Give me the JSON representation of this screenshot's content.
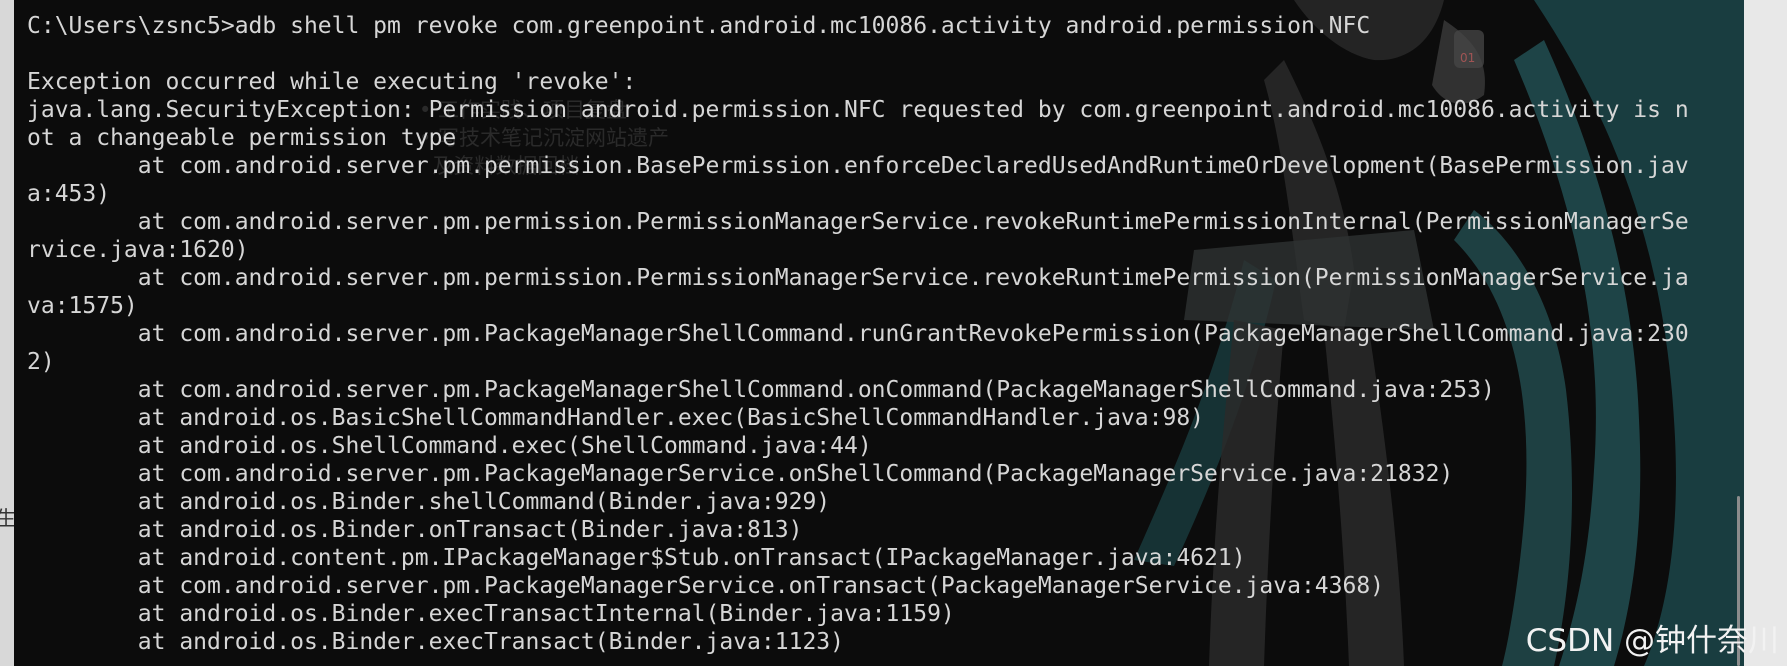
{
  "background_label": "生成目录",
  "faint_text": [
    "• 工作实践、项目复盘",
    "• 写技术笔记沉淀网站遗产",
    "  及资料数据回档"
  ],
  "terminal": {
    "lines": [
      "C:\\Users\\zsnc5>adb shell pm revoke com.greenpoint.android.mc10086.activity android.permission.NFC",
      "",
      "Exception occurred while executing 'revoke':",
      "java.lang.SecurityException: Permission android.permission.NFC requested by com.greenpoint.android.mc10086.activity is n",
      "ot a changeable permission type",
      "        at com.android.server.pm.permission.BasePermission.enforceDeclaredUsedAndRuntimeOrDevelopment(BasePermission.jav",
      "a:453)",
      "        at com.android.server.pm.permission.PermissionManagerService.revokeRuntimePermissionInternal(PermissionManagerSe",
      "rvice.java:1620)",
      "        at com.android.server.pm.permission.PermissionManagerService.revokeRuntimePermission(PermissionManagerService.ja",
      "va:1575)",
      "        at com.android.server.pm.PackageManagerShellCommand.runGrantRevokePermission(PackageManagerShellCommand.java:230",
      "2)",
      "        at com.android.server.pm.PackageManagerShellCommand.onCommand(PackageManagerShellCommand.java:253)",
      "        at android.os.BasicShellCommandHandler.exec(BasicShellCommandHandler.java:98)",
      "        at android.os.ShellCommand.exec(ShellCommand.java:44)",
      "        at com.android.server.pm.PackageManagerService.onShellCommand(PackageManagerService.java:21832)",
      "        at android.os.Binder.shellCommand(Binder.java:929)",
      "        at android.os.Binder.onTransact(Binder.java:813)",
      "        at android.content.pm.IPackageManager$Stub.onTransact(IPackageManager.java:4621)",
      "        at com.android.server.pm.PackageManagerService.onTransact(PackageManagerService.java:4368)",
      "        at android.os.Binder.execTransactInternal(Binder.java:1159)",
      "        at android.os.Binder.execTransact(Binder.java:1123)"
    ]
  },
  "watermark": "CSDN @钟什奈川",
  "colors": {
    "terminal_bg": "#0c0c0c",
    "terminal_text": "#d6d6d6",
    "wallpaper_hair": "#2f6a6d",
    "page_bg": "#e8e8e8"
  }
}
